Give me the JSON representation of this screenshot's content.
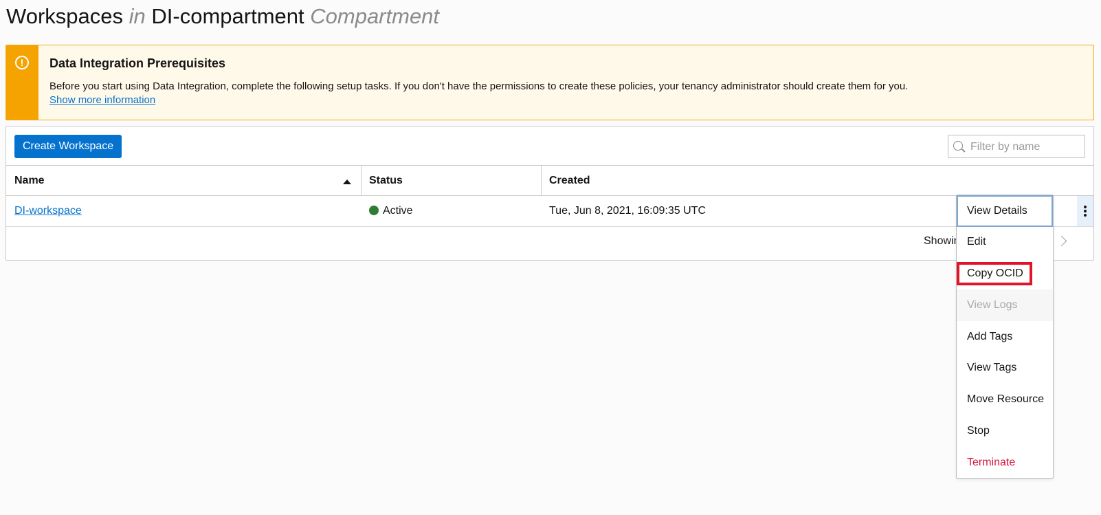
{
  "page": {
    "title_main": "Workspaces",
    "title_in": "in",
    "title_compartment": "DI-compartment",
    "title_compartment_suffix": "Compartment"
  },
  "alert": {
    "icon": "exclamation-circle-icon",
    "title": "Data Integration Prerequisites",
    "body": "Before you start using Data Integration, complete the following setup tasks. If you don't have the permissions to create these policies, your tenancy administrator should create them for you.",
    "link": "Show more information"
  },
  "toolbar": {
    "create_label": "Create Workspace",
    "filter_placeholder": "Filter by name"
  },
  "table": {
    "columns": [
      "Name",
      "Status",
      "Created"
    ],
    "rows": [
      {
        "name": "DI-workspace",
        "status": "Active",
        "created": "Tue, Jun 8, 2021, 16:09:35 UTC"
      }
    ],
    "footer_text": "Showin"
  },
  "menu": {
    "items": [
      {
        "label": "View Details"
      },
      {
        "label": "Edit"
      },
      {
        "label": "Copy OCID"
      },
      {
        "label": "View Logs"
      },
      {
        "label": "Add Tags"
      },
      {
        "label": "View Tags"
      },
      {
        "label": "Move Resource"
      },
      {
        "label": "Stop"
      },
      {
        "label": "Terminate"
      }
    ]
  },
  "colors": {
    "accent": "#0572ce",
    "warning": "#f5a300",
    "active": "#2f7d32",
    "danger": "#d5173f",
    "annotation": "#e3142a"
  }
}
